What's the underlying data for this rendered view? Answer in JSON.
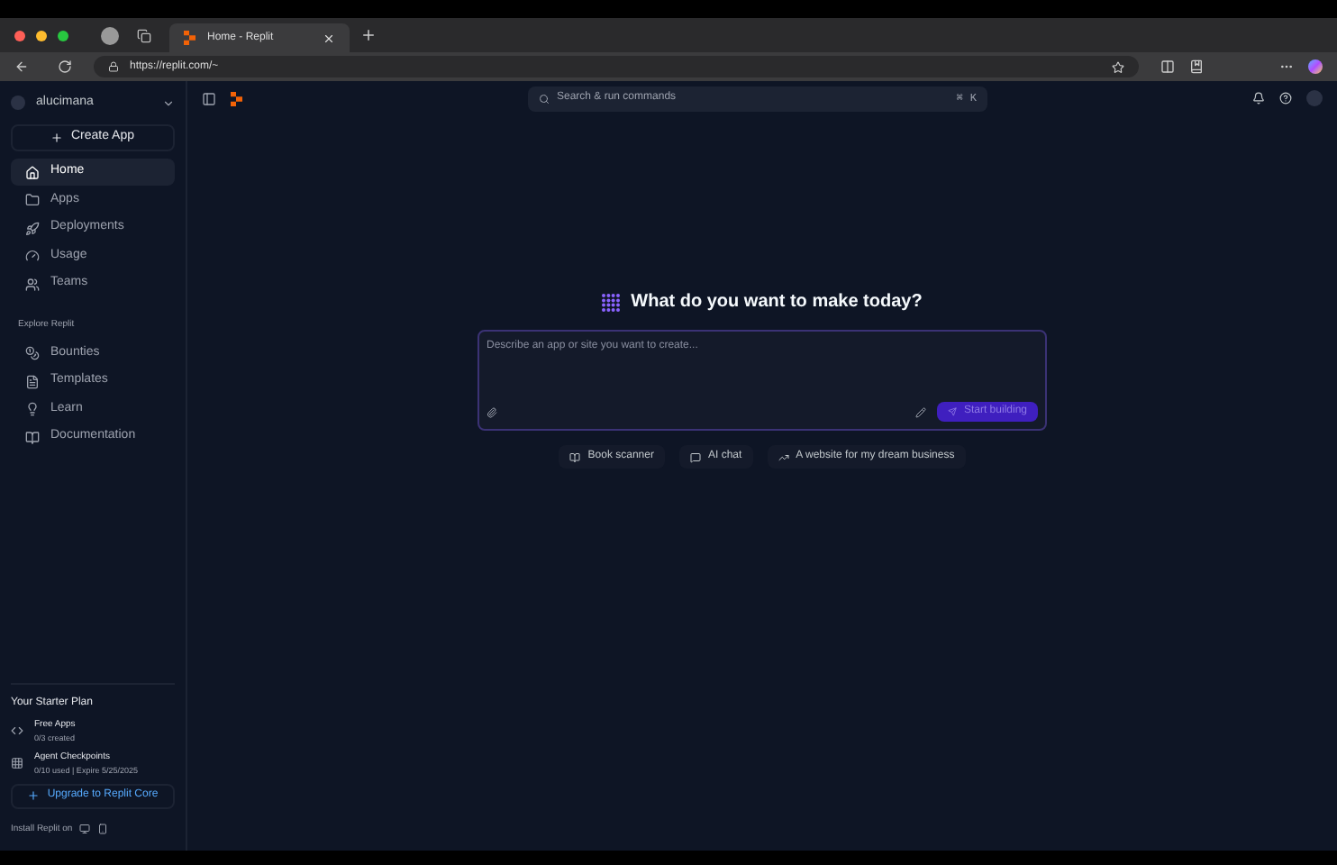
{
  "browser": {
    "tab_title": "Home - Replit",
    "url": "https://replit.com/~"
  },
  "header": {
    "account": "alucimana",
    "search": {
      "placeholder": "Search & run commands",
      "shortcut": [
        "⌘",
        "K"
      ]
    }
  },
  "sidebar": {
    "create_button": "Create App",
    "items": [
      {
        "label": "Home",
        "selected": true
      },
      {
        "label": "Apps",
        "selected": false
      },
      {
        "label": "Deployments",
        "selected": false
      },
      {
        "label": "Usage",
        "selected": false
      },
      {
        "label": "Teams",
        "selected": false
      }
    ],
    "explore_heading": "Explore Replit",
    "explore_items": [
      {
        "label": "Bounties",
        "selected": false
      },
      {
        "label": "Templates",
        "selected": false
      },
      {
        "label": "Learn",
        "selected": false
      },
      {
        "label": "Documentation",
        "selected": false
      }
    ],
    "plan": {
      "title": "Your Starter Plan",
      "items": [
        {
          "name": "Free Apps",
          "detail": "0/3 created"
        },
        {
          "name": "Agent Checkpoints",
          "detail": "0/10 used | Expire 5/25/2025"
        }
      ],
      "upgrade": "Upgrade to Replit Core",
      "install": "Install Replit on"
    }
  },
  "main": {
    "heading": "What do you want to make today?",
    "prompt": {
      "placeholder": "Describe an app or site you want to create..."
    },
    "submit": "Start building",
    "suggestions": [
      {
        "label": "Book scanner"
      },
      {
        "label": "AI chat"
      },
      {
        "label": "A website for my dream business"
      }
    ]
  }
}
